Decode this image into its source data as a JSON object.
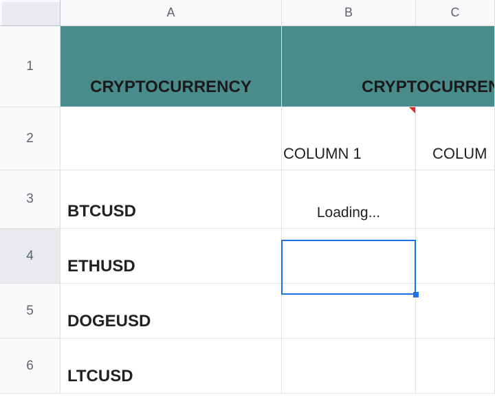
{
  "columns": {
    "a": "A",
    "b": "B",
    "c": "C"
  },
  "rows": {
    "r1": "1",
    "r2": "2",
    "r3": "3",
    "r4": "4",
    "r5": "5",
    "r6": "6"
  },
  "cells": {
    "a1": "CRYPTOCURRENCY",
    "b1c1_merged": "CRYPTOCURREN",
    "b2": "COLUMN 1",
    "c2": "COLUM",
    "a3": "BTCUSD",
    "b3": "Loading...",
    "a4": "ETHUSD",
    "a5": "DOGEUSD",
    "a6": "LTCUSD"
  },
  "selection": {
    "cell": "B4"
  }
}
